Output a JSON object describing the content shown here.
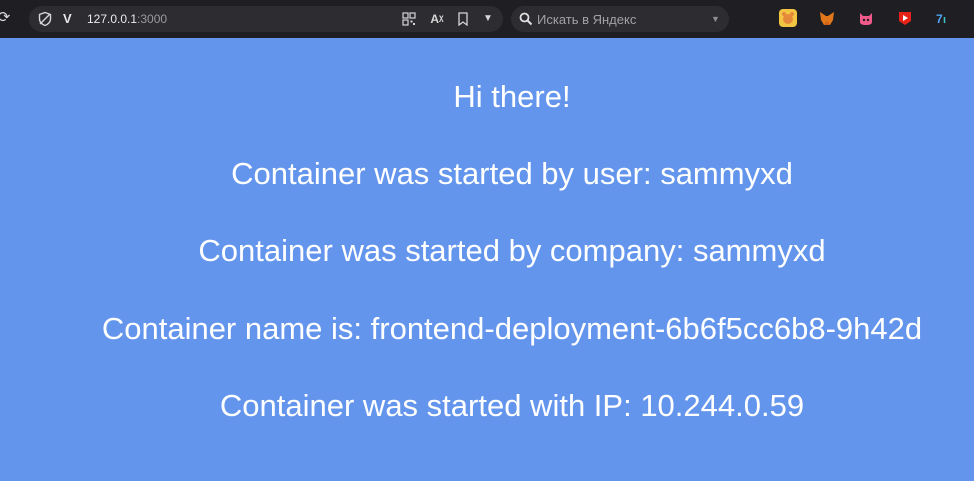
{
  "browser": {
    "url_host": "127.0.0.1",
    "url_port": ":3000",
    "search_placeholder": "Искать в Яндекс"
  },
  "icons": {
    "reload": "reload-icon",
    "shield": "shield-icon",
    "vpn": "vpn-icon",
    "qr": "qr-code-icon",
    "translate": "translate-icon",
    "bookmark": "bookmark-icon",
    "menu": "chevron-down-icon",
    "search": "search-icon",
    "extensions": [
      "bear-extension-icon",
      "metamask-fox-icon",
      "cat-extension-icon",
      "youtube-icon",
      "translate-extension-icon"
    ]
  },
  "page": {
    "greeting": "Hi there!",
    "user_line": "Container was started by user: sammyxd",
    "company_line": "Container was started by company: sammyxd",
    "name_line": "Container name is: frontend-deployment-6b6f5cc6b8-9h42d",
    "ip_line": "Container was started with IP: 10.244.0.59"
  },
  "colors": {
    "page_background": "#6495ed",
    "text": "#ffffff",
    "toolbar": "#1f1f23"
  }
}
